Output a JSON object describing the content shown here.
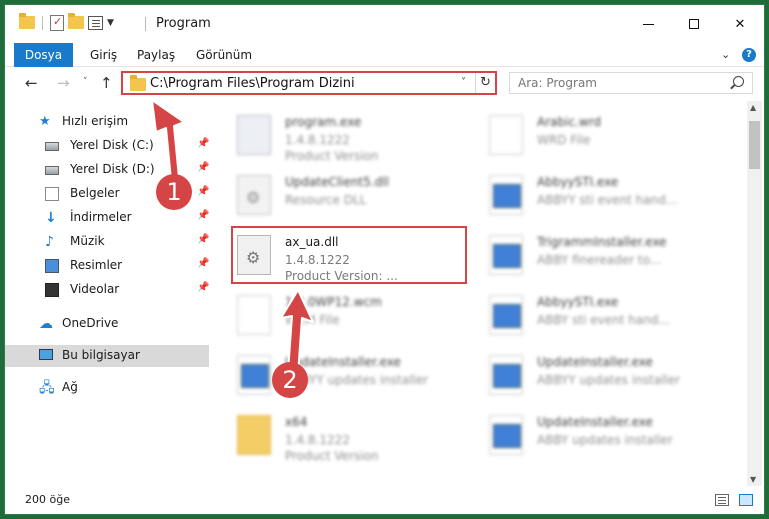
{
  "window": {
    "title": "Program",
    "minimize": "minimize",
    "maximize": "maximize",
    "close": "✕"
  },
  "ribbon": {
    "tabs": [
      "Dosya",
      "Giriş",
      "Paylaş",
      "Görünüm"
    ],
    "expand": "⌄",
    "help": "?"
  },
  "nav": {
    "back": "←",
    "forward": "→",
    "recent": "˅",
    "up": "↑",
    "address": "C:\\Program Files\\Program Dizini",
    "address_dropdown": "˅",
    "refresh": "↻",
    "search_placeholder": "Ara: Program"
  },
  "sidebar": {
    "quick_access": "Hızlı erişim",
    "items": [
      {
        "label": "Yerel Disk (C:)",
        "icon": "disk-icon"
      },
      {
        "label": "Yerel Disk (D:)",
        "icon": "disk-icon"
      },
      {
        "label": "Belgeler",
        "icon": "document-icon"
      },
      {
        "label": "İndirmeler",
        "icon": "download-icon"
      },
      {
        "label": "Müzik",
        "icon": "music-icon"
      },
      {
        "label": "Resimler",
        "icon": "pictures-icon"
      },
      {
        "label": "Videolar",
        "icon": "videos-icon"
      }
    ],
    "onedrive": "OneDrive",
    "this_pc": "Bu bilgisayar",
    "network": "Ağ"
  },
  "files": {
    "left": [
      {
        "name": "program.exe",
        "line2": "1.4.8.1222",
        "line3": "Product Version",
        "blurred": true
      },
      {
        "name": "UpdateClient5.dll",
        "line2": "Resource DLL",
        "line3": "",
        "blurred": true
      },
      {
        "name": "ax_ua.dll",
        "line2": "1.4.8.1222",
        "line3": "Product Version:     ...",
        "blurred": false
      },
      {
        "name": "1.2.0WP12.wcm",
        "line2": "WCM File",
        "line3": "",
        "blurred": true
      },
      {
        "name": "UpdateInstaller.exe",
        "line2": "ABBYY updates installer",
        "line3": "",
        "blurred": true
      },
      {
        "name": "x64",
        "line2": "1.4.8.1222",
        "line3": "Product Version",
        "blurred": true
      }
    ],
    "right": [
      {
        "name": "Arabic.wrd",
        "line2": "WRD File",
        "line3": ""
      },
      {
        "name": "AbbyySTI.exe",
        "line2": "ABBYY sti event hand...",
        "line3": ""
      },
      {
        "name": "TrigrammInstaller.exe",
        "line2": "ABBY finereader to...",
        "line3": ""
      },
      {
        "name": "AbbyySTI.exe",
        "line2": "ABBY sti event hand...",
        "line3": ""
      },
      {
        "name": "UpdateInstaller.exe",
        "line2": "ABBYY updates installer",
        "line3": ""
      },
      {
        "name": "UpdateInstaller.exe",
        "line2": "ABBY updates installer",
        "line3": ""
      }
    ]
  },
  "status": {
    "count": "200 öğe"
  },
  "annotations": {
    "badge1": "1",
    "badge2": "2",
    "color": "#d64545"
  }
}
